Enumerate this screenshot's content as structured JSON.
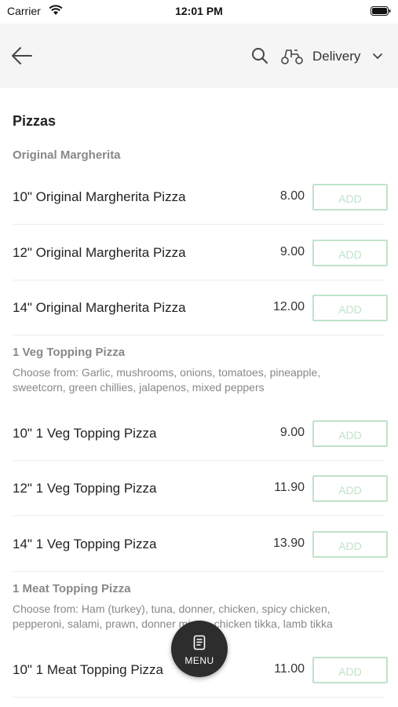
{
  "status_bar": {
    "carrier": "Carrier",
    "time": "12:01 PM"
  },
  "header": {
    "delivery_label": "Delivery"
  },
  "menu": {
    "section_title": "Pizzas",
    "categories": [
      {
        "title": "Original Margherita",
        "description": "",
        "items": [
          {
            "name": "10\" Original Margherita Pizza",
            "price": "8.00",
            "add_label": "ADD"
          },
          {
            "name": "12\" Original Margherita Pizza",
            "price": "9.00",
            "add_label": "ADD"
          },
          {
            "name": "14\" Original Margherita Pizza",
            "price": "12.00",
            "add_label": "ADD"
          }
        ]
      },
      {
        "title": "1 Veg Topping Pizza",
        "description": "Choose from: Garlic, mushrooms, onions, tomatoes, pineapple, sweetcorn, green chillies, jalapenos, mixed peppers",
        "items": [
          {
            "name": "10\" 1 Veg Topping Pizza",
            "price": "9.00",
            "add_label": "ADD"
          },
          {
            "name": "12\" 1 Veg Topping Pizza",
            "price": "11.90",
            "add_label": "ADD"
          },
          {
            "name": "14\" 1 Veg Topping Pizza",
            "price": "13.90",
            "add_label": "ADD"
          }
        ]
      },
      {
        "title": "1 Meat Topping Pizza",
        "description": "Choose from: Ham (turkey), tuna, donner, chicken, spicy chicken, pepperoni, salami, prawn, donner mince, chicken tikka, lamb tikka",
        "items": [
          {
            "name": "10\" 1 Meat Topping Pizza",
            "price": "11.00",
            "add_label": "ADD"
          }
        ]
      }
    ]
  },
  "fab": {
    "label": "MENU"
  },
  "colors": {
    "add_border": "#bfe3c8",
    "header_bg": "#f5f5f5",
    "fab_bg": "#2d2d2d"
  }
}
